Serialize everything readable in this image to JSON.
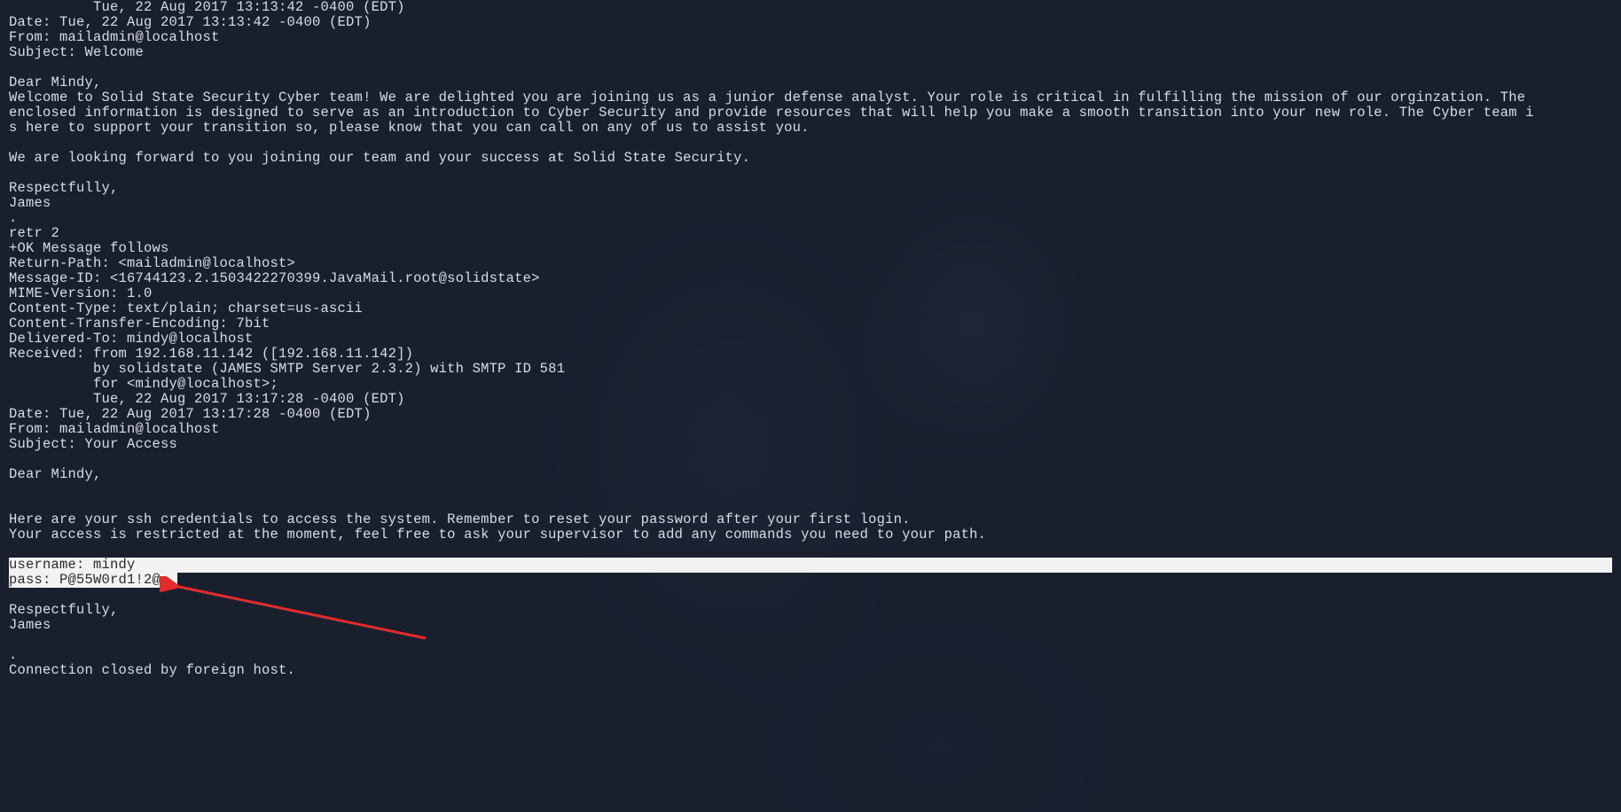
{
  "lines": {
    "l01": "          Tue, 22 Aug 2017 13:13:42 -0400 (EDT)",
    "l02": "Date: Tue, 22 Aug 2017 13:13:42 -0400 (EDT)",
    "l03": "From: mailadmin@localhost",
    "l04": "Subject: Welcome",
    "l05": "",
    "l06": "Dear Mindy,",
    "l07": "Welcome to Solid State Security Cyber team! We are delighted you are joining us as a junior defense analyst. Your role is critical in fulfilling the mission of our orginzation. The ",
    "l08": "enclosed information is designed to serve as an introduction to Cyber Security and provide resources that will help you make a smooth transition into your new role. The Cyber team i",
    "l09": "s here to support your transition so, please know that you can call on any of us to assist you.",
    "l10": "",
    "l11": "We are looking forward to you joining our team and your success at Solid State Security.",
    "l12": "",
    "l13": "Respectfully,",
    "l14": "James",
    "l15": ".",
    "l16": "retr 2",
    "l17": "+OK Message follows",
    "l18": "Return-Path: <mailadmin@localhost>",
    "l19": "Message-ID: <16744123.2.1503422270399.JavaMail.root@solidstate>",
    "l20": "MIME-Version: 1.0",
    "l21": "Content-Type: text/plain; charset=us-ascii",
    "l22": "Content-Transfer-Encoding: 7bit",
    "l23": "Delivered-To: mindy@localhost",
    "l24": "Received: from 192.168.11.142 ([192.168.11.142])",
    "l25": "          by solidstate (JAMES SMTP Server 2.3.2) with SMTP ID 581",
    "l26": "          for <mindy@localhost>;",
    "l27": "          Tue, 22 Aug 2017 13:17:28 -0400 (EDT)",
    "l28": "Date: Tue, 22 Aug 2017 13:17:28 -0400 (EDT)",
    "l29": "From: mailadmin@localhost",
    "l30": "Subject: Your Access",
    "l31": "",
    "l32": "Dear Mindy,",
    "l33": "",
    "l34": "",
    "l35": "Here are your ssh credentials to access the system. Remember to reset your password after your first login.",
    "l36": "Your access is restricted at the moment, feel free to ask your supervisor to add any commands you need to your path.",
    "l37": "",
    "hl1": "username: mindy",
    "hl2": "pass: P@55W0rd1!2@  ",
    "l40": "",
    "l41": "Respectfully,",
    "l42": "James",
    "l43": "",
    "l44": ".",
    "l45": "Connection closed by foreign host."
  },
  "annotation": {
    "arrow_color": "#e22b2b"
  }
}
